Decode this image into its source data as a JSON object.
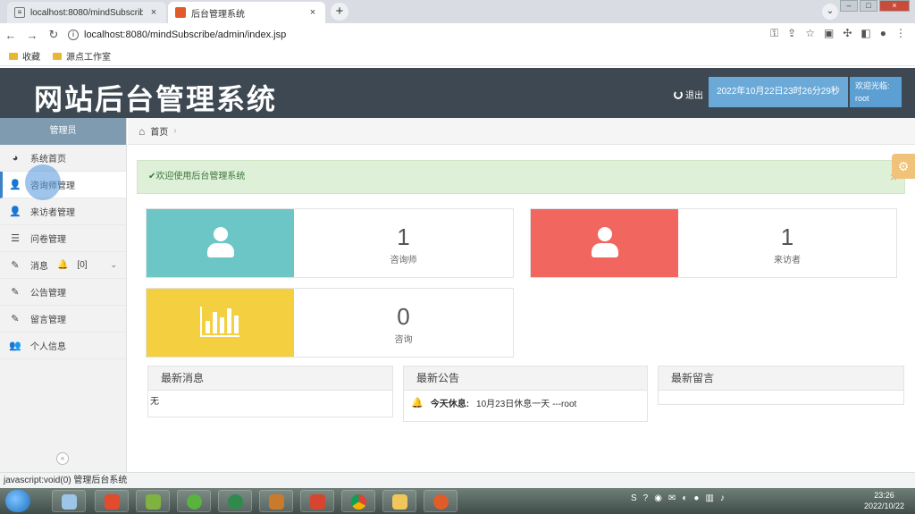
{
  "browser": {
    "tabs": [
      {
        "label": "localhost:8080/mindSubscrib",
        "icon": "page-icon"
      },
      {
        "label": "后台管理系统",
        "icon": "app-favicon"
      }
    ],
    "url": "localhost:8080/mindSubscribe/admin/index.jsp",
    "bookmarks": [
      "收藏",
      "源点工作室"
    ],
    "status_text": "javascript:void(0) 管理后台系统"
  },
  "header": {
    "title": "网站后台管理系统",
    "logout_label": "退出",
    "datetime": "2022年10月22日23时26分29秒",
    "welcome_label": "欢迎光临:",
    "username": "root"
  },
  "sidebar": {
    "role": "管理员",
    "items": [
      {
        "label": "系统首页",
        "icon": "dashboard-icon"
      },
      {
        "label": "咨询师管理",
        "icon": "user-icon"
      },
      {
        "label": "来访者管理",
        "icon": "user-icon"
      },
      {
        "label": "问卷管理",
        "icon": "list-icon"
      },
      {
        "label": "消息",
        "icon": "edit-icon",
        "badge": "[0]"
      },
      {
        "label": "公告管理",
        "icon": "edit-icon"
      },
      {
        "label": "留言管理",
        "icon": "edit-icon"
      },
      {
        "label": "个人信息",
        "icon": "users-icon"
      }
    ]
  },
  "breadcrumb": {
    "home": "首页",
    "separator": "›"
  },
  "alert": {
    "text": "欢迎使用后台管理系统",
    "close": "×"
  },
  "stats": [
    {
      "value": "1",
      "label": "咨询师",
      "color": "#6cc6c6",
      "icon": "person-icon"
    },
    {
      "value": "1",
      "label": "来访者",
      "color": "#f1665e",
      "icon": "person-icon"
    },
    {
      "value": "0",
      "label": "咨询",
      "color": "#f4cf3f",
      "icon": "bar-chart-icon"
    }
  ],
  "panels": {
    "messages": {
      "title": "最新消息",
      "empty": "无"
    },
    "notices": {
      "title": "最新公告",
      "items": [
        {
          "title": "今天休息:",
          "text": "10月23日休息一天 ---root"
        }
      ]
    },
    "comments": {
      "title": "最新留言"
    }
  },
  "taskbar": {
    "time": "23:26",
    "date": "2022/10/22"
  }
}
